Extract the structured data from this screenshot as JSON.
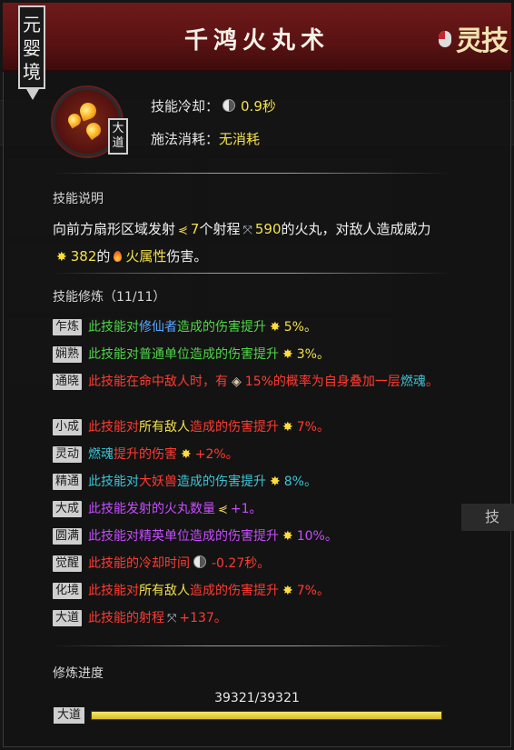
{
  "header": {
    "realm": "元婴境",
    "title": "千鸿火丸术",
    "badge": "灵技"
  },
  "skill": {
    "tier_tag": "大道",
    "cooldown_label": "技能冷却：",
    "cooldown_value": "0.9秒",
    "cost_label": "施法消耗：",
    "cost_value": "无消耗"
  },
  "description": {
    "title": "技能说明",
    "part1": "向前方扇形区域发射",
    "count": "7",
    "part2": "个射程",
    "range": "590",
    "part3": "的火丸，对敌人造成威力",
    "power": "382",
    "part4": "的",
    "element": "火属性",
    "part5": "伤害。"
  },
  "cultivation": {
    "title": "技能修炼（11/11）",
    "items": [
      {
        "tag": "乍炼",
        "a": "此技能对",
        "b": "修仙者",
        "c": "造成的伤害提升",
        "v": "5%。"
      },
      {
        "tag": "娴熟",
        "a": "此技能对普通单位造成的伤害提升",
        "v": "3%。"
      },
      {
        "tag": "通晓",
        "a": "此技能在命中敌人时，有",
        "v": "15%的概率为自身叠加一层",
        "b": "燃魂",
        "c": "。"
      },
      {
        "tag": "小成",
        "a": "此技能对",
        "b": "所有敌人",
        "c": "造成的伤害提升",
        "v": "7%。"
      },
      {
        "tag": "灵动",
        "a": "燃魂",
        "b": "提升的伤害",
        "v": "+2%。"
      },
      {
        "tag": "精通",
        "a": "此技能对",
        "b": "大妖兽",
        "c": "造成的伤害提升",
        "v": "8%。"
      },
      {
        "tag": "大成",
        "a": "此技能发射的火丸数量",
        "v": "+1。"
      },
      {
        "tag": "圆满",
        "a": "此技能对精英单位造成的伤害提升",
        "v": "10%。"
      },
      {
        "tag": "觉醒",
        "a": "此技能的冷却时间",
        "v": "-0.27秒。"
      },
      {
        "tag": "化境",
        "a": "此技能对",
        "b": "所有敌人",
        "c": "造成的伤害提升",
        "v": "7%。"
      },
      {
        "tag": "大道",
        "a": "此技能的射程",
        "v": "+137。"
      }
    ]
  },
  "progress": {
    "title": "修炼进度",
    "value_text": "39321/39321",
    "tag": "大道",
    "fraction": 1.0
  },
  "side_tab": "技"
}
